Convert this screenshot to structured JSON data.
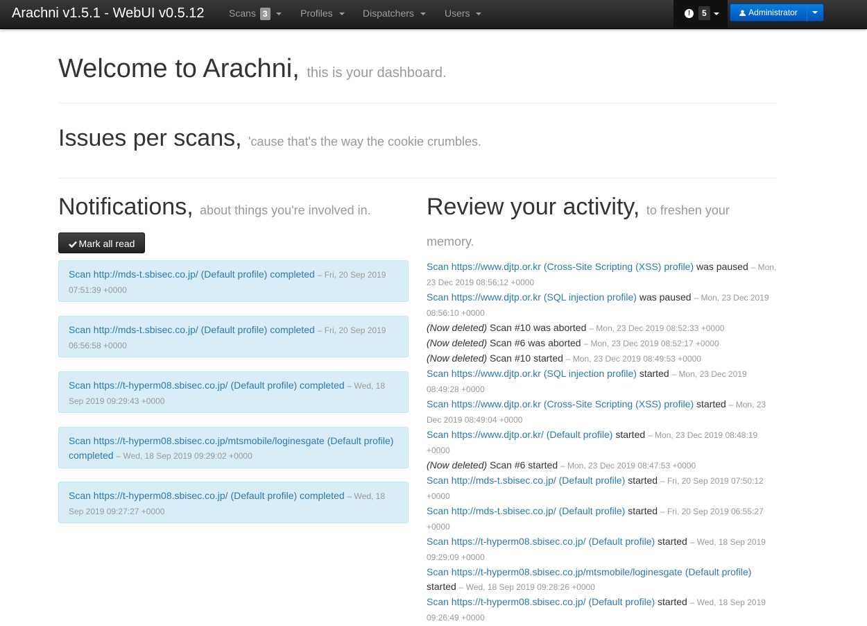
{
  "navbar": {
    "brand": "Arachni v1.5.1 - WebUI v0.5.12",
    "scans_label": "Scans",
    "scans_count": "3",
    "profiles_label": "Profiles",
    "dispatchers_label": "Dispatchers",
    "users_label": "Users",
    "notifications_count": "5",
    "admin_label": "Administrator"
  },
  "welcome": {
    "title": "Welcome to Arachni,",
    "subtitle": "this is your dashboard."
  },
  "issues": {
    "title": "Issues per scans,",
    "subtitle": "'cause that's the way the cookie crumbles."
  },
  "notifications": {
    "title": "Notifications,",
    "subtitle": "about things you're involved in.",
    "mark_all_read": "Mark all read",
    "items": [
      {
        "link": "Scan http://mds-t.sbisec.co.jp/ (Default profile)",
        "status": "completed",
        "time": "– Fri, 20 Sep 2019 07:51:39 +0000"
      },
      {
        "link": "Scan http://mds-t.sbisec.co.jp/ (Default profile)",
        "status": "completed",
        "time": "– Fri, 20 Sep 2019 06:56:58 +0000"
      },
      {
        "link": "Scan https://t-hyperm08.sbisec.co.jp/ (Default profile)",
        "status": "completed",
        "time": "– Wed, 18 Sep 2019 09:29:43 +0000"
      },
      {
        "link": "Scan https://t-hyperm08.sbisec.co.jp/mtsmobile/loginesgate (Default profile)",
        "status": "completed",
        "time": "– Wed, 18 Sep 2019 09:29:02 +0000"
      },
      {
        "link": "Scan https://t-hyperm08.sbisec.co.jp/ (Default profile)",
        "status": "completed",
        "time": "– Wed, 18 Sep 2019 09:27:27 +0000"
      }
    ]
  },
  "activity": {
    "title": "Review your activity,",
    "subtitle": "to freshen your memory.",
    "items": [
      {
        "deleted": "",
        "link": "Scan https://www.djtp.or.kr (Cross-Site Scripting (XSS) profile)",
        "text": "was paused",
        "time": "– Mon, 23 Dec 2019 08:56:12 +0000"
      },
      {
        "deleted": "",
        "link": "Scan https://www.djtp.or.kr (SQL injection profile)",
        "text": "was paused",
        "time": "– Mon, 23 Dec 2019 08:56:10 +0000"
      },
      {
        "deleted": "(Now deleted)",
        "link": "",
        "text": "Scan #10 was aborted",
        "time": "– Mon, 23 Dec 2019 08:52:33 +0000"
      },
      {
        "deleted": "(Now deleted)",
        "link": "",
        "text": "Scan #6 was aborted",
        "time": "– Mon, 23 Dec 2019 08:52:17 +0000"
      },
      {
        "deleted": "(Now deleted)",
        "link": "",
        "text": "Scan #10 started",
        "time": "– Mon, 23 Dec 2019 08:49:53 +0000"
      },
      {
        "deleted": "",
        "link": "Scan https://www.djtp.or.kr (SQL injection profile)",
        "text": "started",
        "time": "– Mon, 23 Dec 2019 08:49:28 +0000"
      },
      {
        "deleted": "",
        "link": "Scan https://www.djtp.or.kr (Cross-Site Scripting (XSS) profile)",
        "text": "started",
        "time": "– Mon, 23 Dec 2019 08:49:04 +0000"
      },
      {
        "deleted": "",
        "link": "Scan https://www.djtp.or.kr/ (Default profile)",
        "text": "started",
        "time": "– Mon, 23 Dec 2019 08:48:19 +0000"
      },
      {
        "deleted": "(Now deleted)",
        "link": "",
        "text": "Scan #6 started",
        "time": "– Mon, 23 Dec 2019 08:47:53 +0000"
      },
      {
        "deleted": "",
        "link": "Scan http://mds-t.sbisec.co.jp/ (Default profile)",
        "text": "started",
        "time": "– Fri, 20 Sep 2019 07:50:12 +0000"
      },
      {
        "deleted": "",
        "link": "Scan http://mds-t.sbisec.co.jp/ (Default profile)",
        "text": "started",
        "time": "– Fri, 20 Sep 2019 06:55:27 +0000"
      },
      {
        "deleted": "",
        "link": "Scan https://t-hyperm08.sbisec.co.jp/ (Default profile)",
        "text": "started",
        "time": "– Wed, 18 Sep 2019 09:29:09 +0000"
      },
      {
        "deleted": "",
        "link": "Scan https://t-hyperm08.sbisec.co.jp/mtsmobile/loginesgate (Default profile)",
        "text": "started",
        "time": "– Wed, 18 Sep 2019 09:28:26 +0000"
      },
      {
        "deleted": "",
        "link": "Scan https://t-hyperm08.sbisec.co.jp/ (Default profile)",
        "text": "started",
        "time": "– Wed, 18 Sep 2019 09:26:49 +0000"
      }
    ]
  },
  "colors": {
    "navbar": "#222222",
    "link": "#2a7ab0",
    "alert_bg": "#d9edf7",
    "primary_button": "#0a7fe0"
  },
  "icons": {
    "notifications": "exclamation-circle-icon",
    "admin": "user-icon",
    "mark_all_read": "check-icon"
  }
}
